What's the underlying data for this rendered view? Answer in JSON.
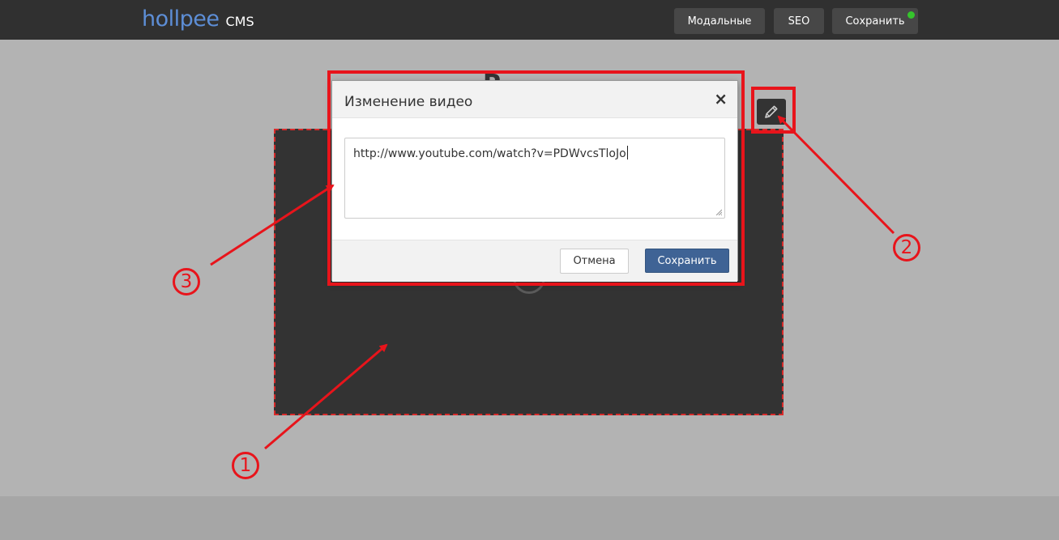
{
  "header": {
    "logo_word": "hollpee",
    "logo_suffix": "CMS",
    "buttons": {
      "modals": "Модальные",
      "seo": "SEO",
      "save": "Сохранить"
    },
    "save_status_color": "#35c42c"
  },
  "page": {
    "heading_peek": "P"
  },
  "modal": {
    "title": "Изменение видео",
    "close_symbol": "×",
    "video_url": "http://www.youtube.com/watch?v=PDWvcsTloJo",
    "cancel_label": "Отмена",
    "save_label": "Сохранить"
  },
  "annotations": {
    "labels": [
      "1",
      "2",
      "3"
    ],
    "color": "#e8141b"
  },
  "icons": {
    "edit": "pencil-icon",
    "close": "close-icon",
    "status": "status-dot"
  },
  "colors": {
    "topbar": "#303030",
    "page_bg": "#b3b3b3",
    "logo": "#5d8ed6",
    "primary_button": "#3f6395",
    "video_block": "#333333"
  }
}
